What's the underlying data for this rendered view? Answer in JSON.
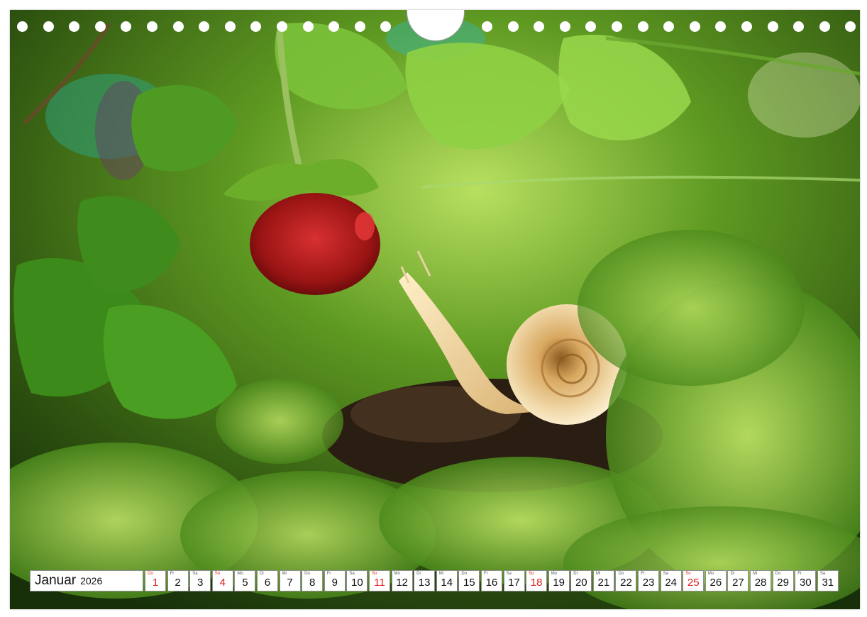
{
  "calendar": {
    "month": "Januar",
    "year": "2026",
    "days": [
      {
        "wd": "Do",
        "num": "1",
        "holiday": true
      },
      {
        "wd": "Fr",
        "num": "2"
      },
      {
        "wd": "Sa",
        "num": "3"
      },
      {
        "wd": "So",
        "num": "4",
        "holiday": true
      },
      {
        "wd": "Mo",
        "num": "5"
      },
      {
        "wd": "Di",
        "num": "6"
      },
      {
        "wd": "Mi",
        "num": "7"
      },
      {
        "wd": "Do",
        "num": "8"
      },
      {
        "wd": "Fr",
        "num": "9"
      },
      {
        "wd": "Sa",
        "num": "10"
      },
      {
        "wd": "So",
        "num": "11",
        "holiday": true
      },
      {
        "wd": "Mo",
        "num": "12"
      },
      {
        "wd": "Di",
        "num": "13"
      },
      {
        "wd": "Mi",
        "num": "14"
      },
      {
        "wd": "Do",
        "num": "15"
      },
      {
        "wd": "Fr",
        "num": "16"
      },
      {
        "wd": "Sa",
        "num": "17"
      },
      {
        "wd": "So",
        "num": "18",
        "holiday": true
      },
      {
        "wd": "Mo",
        "num": "19"
      },
      {
        "wd": "Di",
        "num": "20"
      },
      {
        "wd": "Mi",
        "num": "21"
      },
      {
        "wd": "Do",
        "num": "22"
      },
      {
        "wd": "Fr",
        "num": "23"
      },
      {
        "wd": "Sa",
        "num": "24"
      },
      {
        "wd": "So",
        "num": "25",
        "holiday": true
      },
      {
        "wd": "Mo",
        "num": "26"
      },
      {
        "wd": "Di",
        "num": "27"
      },
      {
        "wd": "Mi",
        "num": "28"
      },
      {
        "wd": "Do",
        "num": "29"
      },
      {
        "wd": "Fr",
        "num": "30"
      },
      {
        "wd": "Sa",
        "num": "31"
      }
    ]
  },
  "colors": {
    "holiday": "#e02020",
    "foliage": "#3f7a1a",
    "moss": "#8cc43a"
  }
}
